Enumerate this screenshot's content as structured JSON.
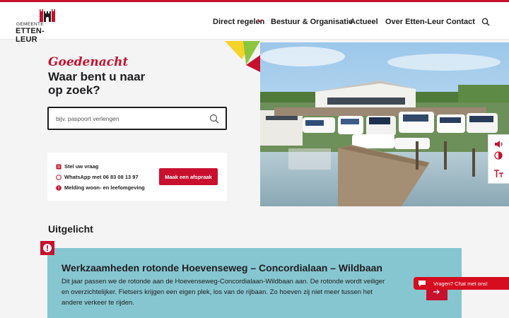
{
  "brand": {
    "line1": "GEMEENTE",
    "line2": "ETTEN-LEUR",
    "accent_color": "#c8102e"
  },
  "nav": {
    "items": [
      {
        "label": "Direct regelen",
        "has_dropdown": true
      },
      {
        "label": "Bestuur & Organisatie"
      },
      {
        "label": "Actueel"
      },
      {
        "label": "Over Etten-Leur"
      },
      {
        "label": "Contact"
      }
    ],
    "search_icon": "search-icon",
    "dropdown_icon": "chevron-down-icon"
  },
  "hero": {
    "greeting": "Goedenacht",
    "headline": "Waar bent u naar op zoek?",
    "search_placeholder": "bijv. paspoort verlengen",
    "image_icon": "marina-photo"
  },
  "contact": {
    "items": [
      {
        "label": "Stel uw vraag",
        "icon": "form-icon"
      },
      {
        "label": "WhatsApp met 06 83 08 13 97",
        "icon": "whatsapp-icon"
      },
      {
        "label": "Melding woon- en leefomgeving",
        "icon": "alert-icon"
      }
    ],
    "appointment_button": "Maak een afspraak"
  },
  "accessibility": {
    "icons": [
      "speaker-icon",
      "contrast-icon",
      "text-size-icon"
    ]
  },
  "featured": {
    "section_title": "Uitgelicht",
    "title": "Werkzaamheden rotonde Hoevenseweg – Concordialaan – Wildbaan",
    "body": "Dit jaar passen we de rotonde aan de Hoevenseweg-Concordialaan-Wildbaan aan. De rotonde wordt veiliger en overzichtelijker. Fietsers krijgen een eigen plek, los van de rijbaan. Zo hoeven zij niet meer tussen het andere verkeer te rijden.",
    "background_color": "#86c6d0"
  },
  "chat": {
    "label": "Vragen? Chat met ons!",
    "icon": "chat-bubble-icon"
  }
}
